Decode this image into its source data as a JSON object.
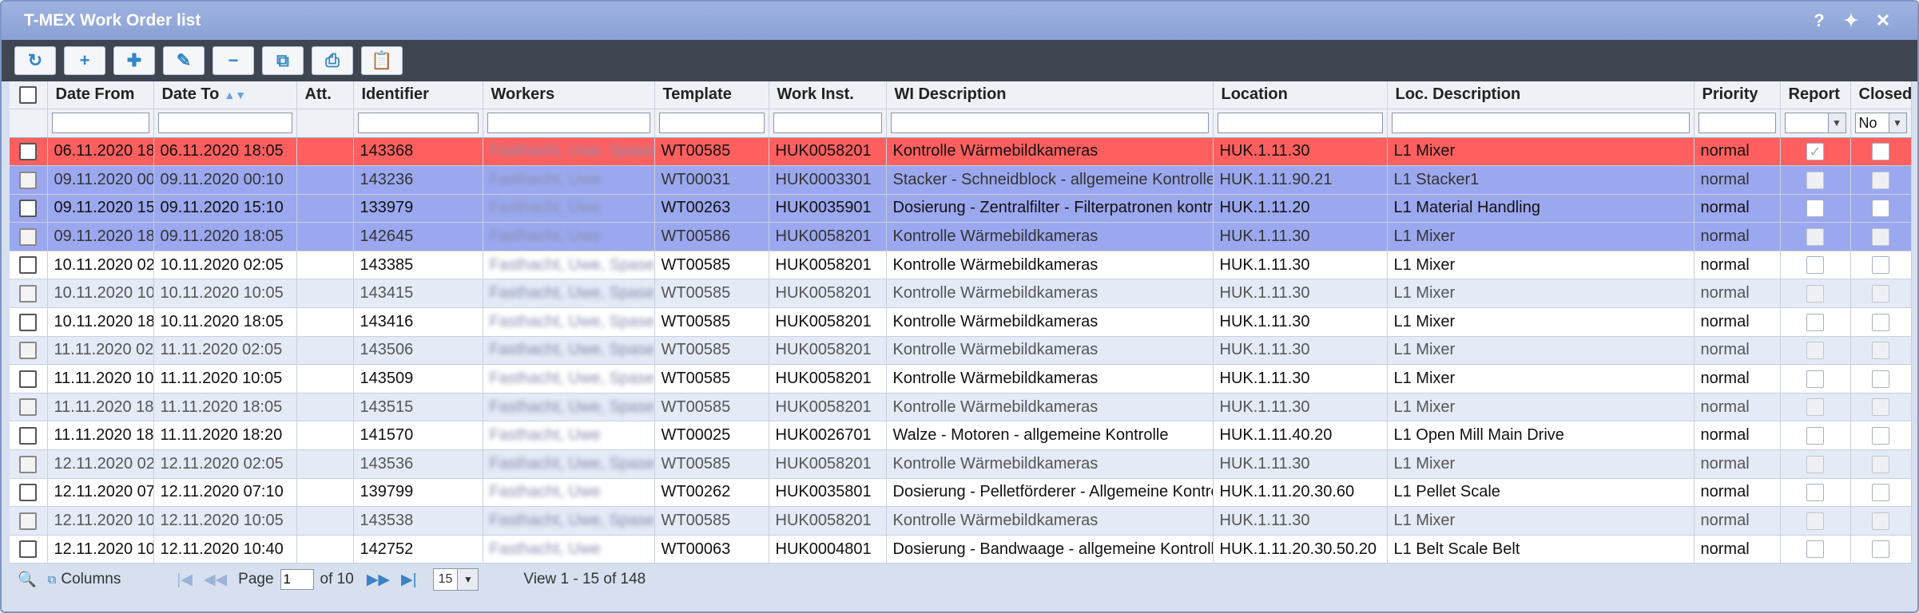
{
  "window": {
    "title": "T-MEX Work Order list"
  },
  "titlebar_icons": [
    "help-icon",
    "pin-icon",
    "close-icon"
  ],
  "toolbar": [
    {
      "name": "refresh-button",
      "icon": "↻"
    },
    {
      "name": "add-button",
      "icon": "+"
    },
    {
      "name": "add-multiple-button",
      "icon": "✚"
    },
    {
      "name": "edit-button",
      "icon": "✎"
    },
    {
      "name": "delete-button",
      "icon": "−"
    },
    {
      "name": "copy-button",
      "icon": "⧉"
    },
    {
      "name": "print-button",
      "icon": "⎙"
    },
    {
      "name": "clipboard-button",
      "icon": "📋"
    }
  ],
  "columns": [
    "Date From",
    "Date To",
    "Att.",
    "Identifier",
    "Workers",
    "Template",
    "Work Inst.",
    "WI Description",
    "Location",
    "Loc. Description",
    "Priority",
    "Report",
    "Closed"
  ],
  "filters": {
    "closed_value": "No"
  },
  "rows": [
    {
      "style": "r-red",
      "date_from": "06.11.2020 18",
      "date_to": "06.11.2020 18:05",
      "id": "143368",
      "workers": "Fasthacht, Uwe, Spase",
      "template": "WT00585",
      "wi": "HUK0058201",
      "wi_desc": "Kontrolle Wärmebildkameras",
      "loc": "HUK.1.11.30",
      "loc_desc": "L1 Mixer",
      "priority": "normal",
      "report": true
    },
    {
      "style": "r-selalt",
      "date_from": "09.11.2020 00",
      "date_to": "09.11.2020 00:10",
      "id": "143236",
      "workers": "Fasthacht, Uwe",
      "template": "WT00031",
      "wi": "HUK0003301",
      "wi_desc": "Stacker - Schneidblock - allgemeine Kontrolle",
      "loc": "HUK.1.11.90.21",
      "loc_desc": "L1 Stacker1",
      "priority": "normal",
      "report": false
    },
    {
      "style": "r-sel",
      "date_from": "09.11.2020 15",
      "date_to": "09.11.2020 15:10",
      "id": "133979",
      "workers": "Fasthacht, Uwe",
      "template": "WT00263",
      "wi": "HUK0035901",
      "wi_desc": "Dosierung - Zentralfilter - Filterpatronen kontrollieren",
      "loc": "HUK.1.11.20",
      "loc_desc": "L1 Material Handling",
      "priority": "normal",
      "report": false
    },
    {
      "style": "r-selalt",
      "date_from": "09.11.2020 18",
      "date_to": "09.11.2020 18:05",
      "id": "142645",
      "workers": "Fasthacht, Uwe",
      "template": "WT00586",
      "wi": "HUK0058201",
      "wi_desc": "Kontrolle Wärmebildkameras",
      "loc": "HUK.1.11.30",
      "loc_desc": "L1 Mixer",
      "priority": "normal",
      "report": false
    },
    {
      "style": "r-white",
      "date_from": "10.11.2020 02",
      "date_to": "10.11.2020 02:05",
      "id": "143385",
      "workers": "Fasthacht, Uwe, Spase",
      "template": "WT00585",
      "wi": "HUK0058201",
      "wi_desc": "Kontrolle Wärmebildkameras",
      "loc": "HUK.1.11.30",
      "loc_desc": "L1 Mixer",
      "priority": "normal",
      "report": false
    },
    {
      "style": "r-alt",
      "date_from": "10.11.2020 10",
      "date_to": "10.11.2020 10:05",
      "id": "143415",
      "workers": "Fasthacht, Uwe, Spase",
      "template": "WT00585",
      "wi": "HUK0058201",
      "wi_desc": "Kontrolle Wärmebildkameras",
      "loc": "HUK.1.11.30",
      "loc_desc": "L1 Mixer",
      "priority": "normal",
      "report": false
    },
    {
      "style": "r-white",
      "date_from": "10.11.2020 18",
      "date_to": "10.11.2020 18:05",
      "id": "143416",
      "workers": "Fasthacht, Uwe, Spase",
      "template": "WT00585",
      "wi": "HUK0058201",
      "wi_desc": "Kontrolle Wärmebildkameras",
      "loc": "HUK.1.11.30",
      "loc_desc": "L1 Mixer",
      "priority": "normal",
      "report": false
    },
    {
      "style": "r-alt",
      "date_from": "11.11.2020 02",
      "date_to": "11.11.2020 02:05",
      "id": "143506",
      "workers": "Fasthacht, Uwe, Spase",
      "template": "WT00585",
      "wi": "HUK0058201",
      "wi_desc": "Kontrolle Wärmebildkameras",
      "loc": "HUK.1.11.30",
      "loc_desc": "L1 Mixer",
      "priority": "normal",
      "report": false
    },
    {
      "style": "r-white",
      "date_from": "11.11.2020 10",
      "date_to": "11.11.2020 10:05",
      "id": "143509",
      "workers": "Fasthacht, Uwe, Spase",
      "template": "WT00585",
      "wi": "HUK0058201",
      "wi_desc": "Kontrolle Wärmebildkameras",
      "loc": "HUK.1.11.30",
      "loc_desc": "L1 Mixer",
      "priority": "normal",
      "report": false
    },
    {
      "style": "r-alt",
      "date_from": "11.11.2020 18",
      "date_to": "11.11.2020 18:05",
      "id": "143515",
      "workers": "Fasthacht, Uwe, Spase",
      "template": "WT00585",
      "wi": "HUK0058201",
      "wi_desc": "Kontrolle Wärmebildkameras",
      "loc": "HUK.1.11.30",
      "loc_desc": "L1 Mixer",
      "priority": "normal",
      "report": false
    },
    {
      "style": "r-white",
      "date_from": "11.11.2020 18",
      "date_to": "11.11.2020 18:20",
      "id": "141570",
      "workers": "Fasthacht, Uwe",
      "template": "WT00025",
      "wi": "HUK0026701",
      "wi_desc": "Walze - Motoren - allgemeine Kontrolle",
      "loc": "HUK.1.11.40.20",
      "loc_desc": "L1 Open Mill Main Drive",
      "priority": "normal",
      "report": false
    },
    {
      "style": "r-alt",
      "date_from": "12.11.2020 02",
      "date_to": "12.11.2020 02:05",
      "id": "143536",
      "workers": "Fasthacht, Uwe, Spase",
      "template": "WT00585",
      "wi": "HUK0058201",
      "wi_desc": "Kontrolle Wärmebildkameras",
      "loc": "HUK.1.11.30",
      "loc_desc": "L1 Mixer",
      "priority": "normal",
      "report": false
    },
    {
      "style": "r-white",
      "date_from": "12.11.2020 07",
      "date_to": "12.11.2020 07:10",
      "id": "139799",
      "workers": "Fasthacht, Uwe",
      "template": "WT00262",
      "wi": "HUK0035801",
      "wi_desc": "Dosierung - Pelletförderer - Allgemeine Kontrolle",
      "loc": "HUK.1.11.20.30.60",
      "loc_desc": "L1 Pellet Scale",
      "priority": "normal",
      "report": false
    },
    {
      "style": "r-alt",
      "date_from": "12.11.2020 10",
      "date_to": "12.11.2020 10:05",
      "id": "143538",
      "workers": "Fasthacht, Uwe, Spase",
      "template": "WT00585",
      "wi": "HUK0058201",
      "wi_desc": "Kontrolle Wärmebildkameras",
      "loc": "HUK.1.11.30",
      "loc_desc": "L1 Mixer",
      "priority": "normal",
      "report": false
    },
    {
      "style": "r-white",
      "date_from": "12.11.2020 10",
      "date_to": "12.11.2020 10:40",
      "id": "142752",
      "workers": "Fasthacht, Uwe",
      "template": "WT00063",
      "wi": "HUK0004801",
      "wi_desc": "Dosierung - Bandwaage - allgemeine Kontrolle",
      "loc": "HUK.1.11.20.30.50.20",
      "loc_desc": "L1 Belt Scale Belt",
      "priority": "normal",
      "report": false
    }
  ],
  "pager": {
    "columns_label": "Columns",
    "page_label": "Page",
    "page_value": "1",
    "of_label": "of 10",
    "page_size": "15",
    "view_label": "View 1 - 15 of 148"
  }
}
